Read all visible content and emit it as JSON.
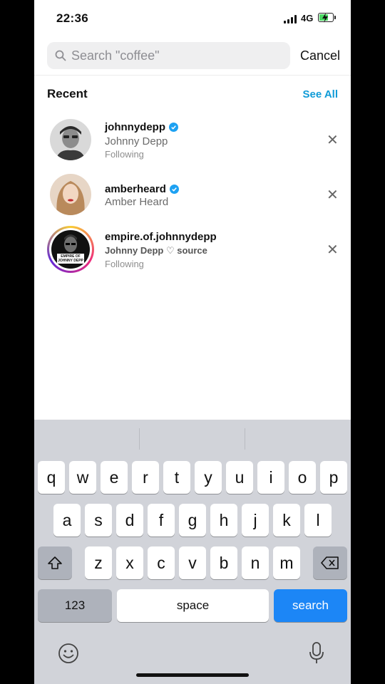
{
  "status_bar": {
    "time": "22:36",
    "network": "4G"
  },
  "search": {
    "placeholder": "Search \"coffee\"",
    "value": "",
    "cancel_label": "Cancel"
  },
  "recent": {
    "title": "Recent",
    "see_all_label": "See All",
    "items": [
      {
        "username": "johnnydepp",
        "verified": true,
        "full_name": "Johnny Depp",
        "meta": "Following"
      },
      {
        "username": "amberheard",
        "verified": true,
        "full_name": "Amber Heard",
        "meta": ""
      },
      {
        "username": "empire.of.johnnydepp",
        "verified": false,
        "full_name": "Johnny Depp ♡ source",
        "meta": "Following",
        "avatar_text": "EMPIRE OF JOHNNY DEPP"
      }
    ]
  },
  "keyboard": {
    "row1": [
      "q",
      "w",
      "e",
      "r",
      "t",
      "y",
      "u",
      "i",
      "o",
      "p"
    ],
    "row2": [
      "a",
      "s",
      "d",
      "f",
      "g",
      "h",
      "j",
      "k",
      "l"
    ],
    "row3": [
      "z",
      "x",
      "c",
      "v",
      "b",
      "n",
      "m"
    ],
    "numbers_label": "123",
    "space_label": "space",
    "search_label": "search"
  },
  "colors": {
    "accent": "#0f9bd7",
    "search_key": "#1c86f6",
    "verified": "#1da1f2"
  }
}
